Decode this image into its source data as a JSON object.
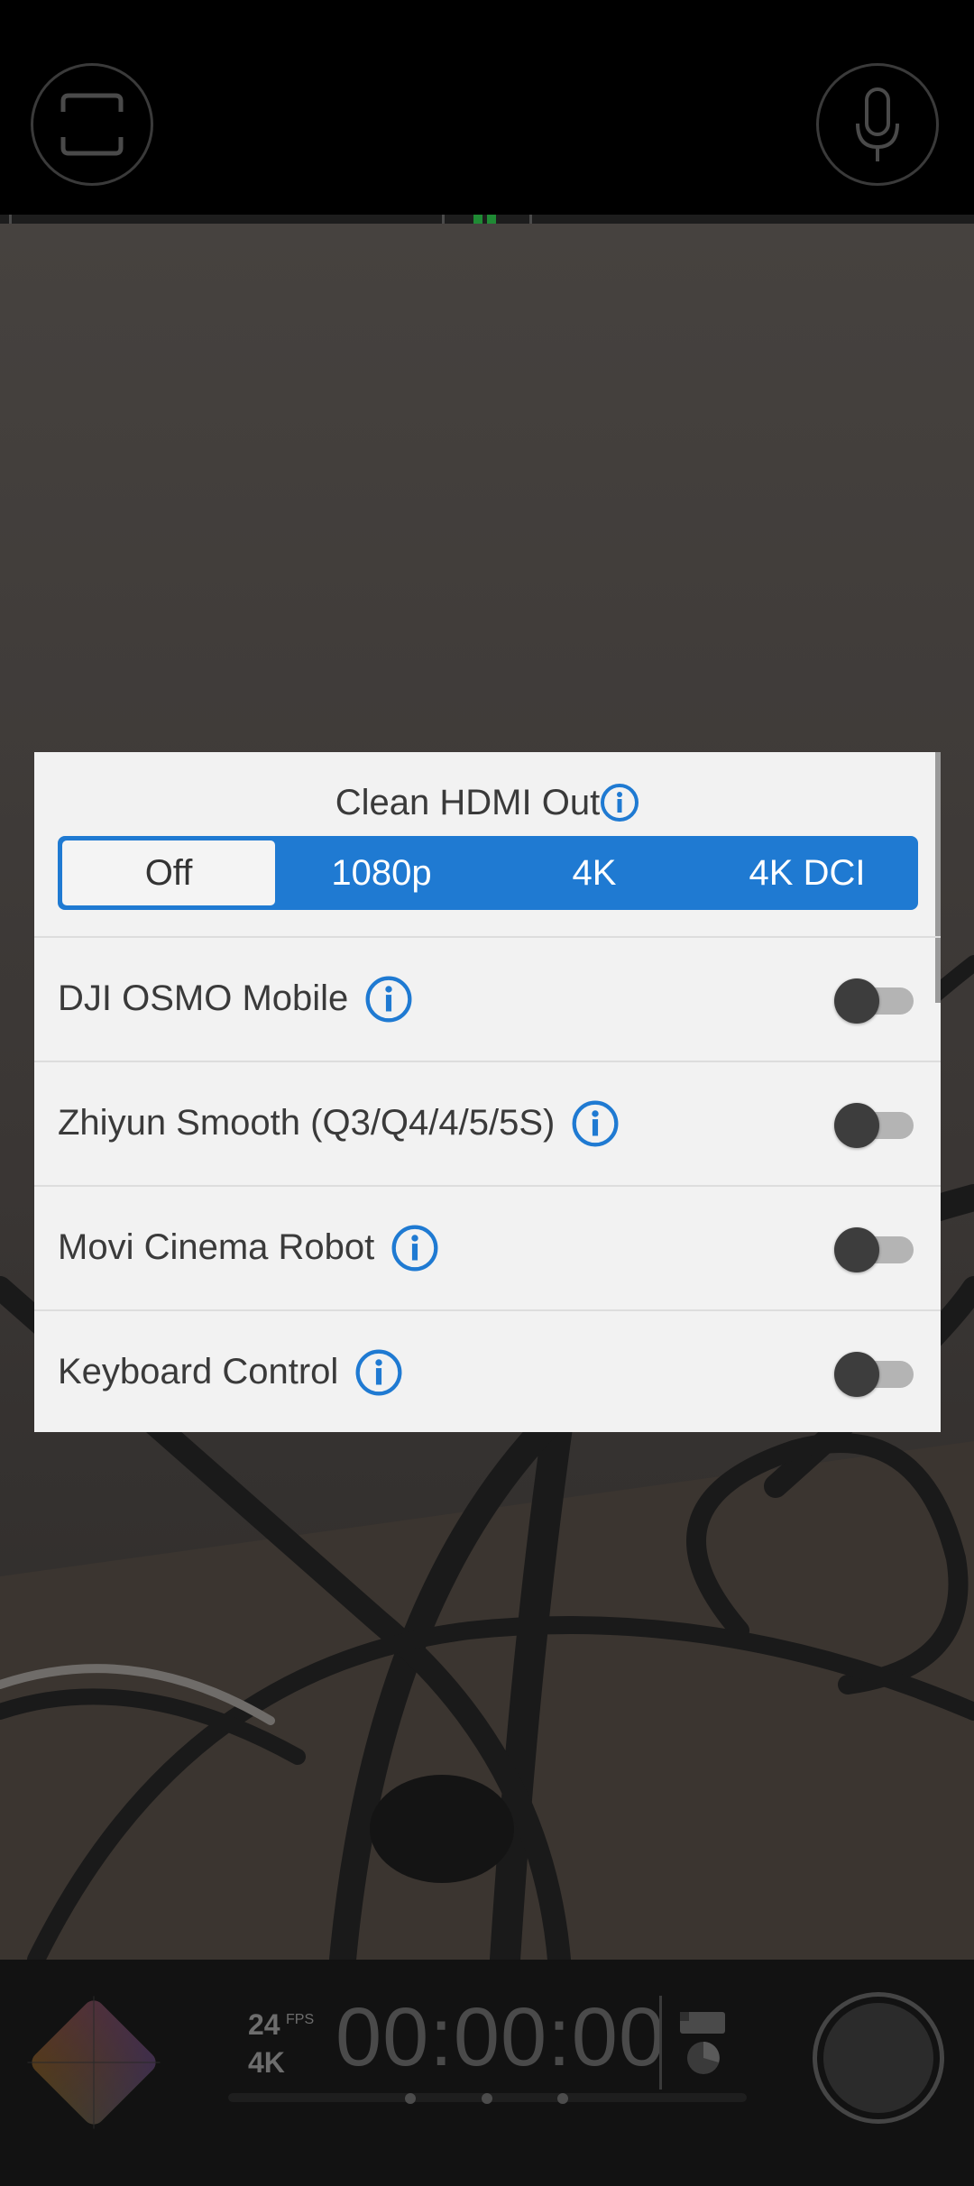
{
  "top_bar": {
    "left_button_icon": "frame-guides-icon",
    "right_button_icon": "microphone-icon"
  },
  "dialog": {
    "title": "Clean HDMI Out",
    "hdmi_options": [
      "Off",
      "1080p",
      "4K",
      "4K DCI"
    ],
    "hdmi_selected": "Off",
    "rows": [
      {
        "label": "DJI OSMO Mobile",
        "enabled": false
      },
      {
        "label": "Zhiyun Smooth (Q3/Q4/4/5/5S)",
        "enabled": false
      },
      {
        "label": "Movi Cinema Robot",
        "enabled": false
      },
      {
        "label": "Keyboard Control",
        "enabled": false
      }
    ]
  },
  "bottom_bar": {
    "fps": "24",
    "fps_unit": "FPS",
    "resolution": "4K",
    "timecode": "00:00:00",
    "lut_icon": "color-lut-icon",
    "storage_icon": "storage-icon",
    "record_icon": "record-button"
  },
  "colors": {
    "accent": "#1f7ad2",
    "dialog_bg": "#f2f2f2",
    "text": "#3a3a3a"
  }
}
